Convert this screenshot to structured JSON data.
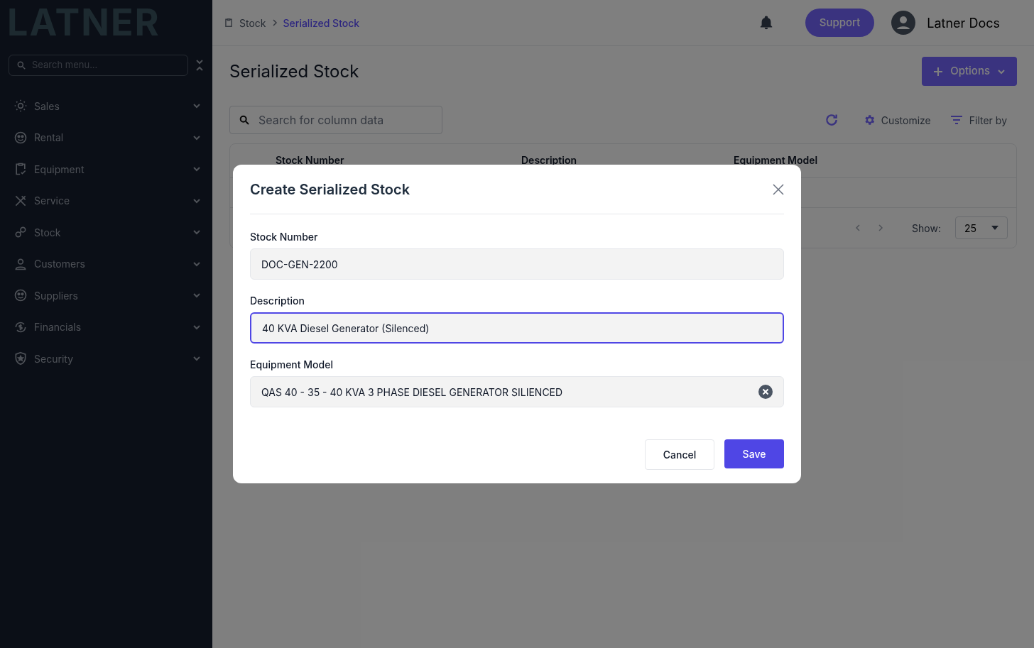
{
  "logo": {
    "text": "LATNER"
  },
  "sidebar": {
    "search_placeholder": "Search menu...",
    "items": [
      {
        "label": "Sales"
      },
      {
        "label": "Rental"
      },
      {
        "label": "Equipment"
      },
      {
        "label": "Service"
      },
      {
        "label": "Stock"
      },
      {
        "label": "Customers"
      },
      {
        "label": "Suppliers"
      },
      {
        "label": "Financials"
      },
      {
        "label": "Security"
      }
    ]
  },
  "header": {
    "breadcrumb": [
      {
        "label": "Stock",
        "selected": false
      },
      {
        "label": "Serialized Stock",
        "selected": true
      }
    ],
    "support": "Support",
    "user": "Latner Docs"
  },
  "page": {
    "title": "Serialized Stock",
    "options": "Options",
    "search_placeholder": "Search for column data",
    "customize": "Customize",
    "filter": "Filter by",
    "table": {
      "columns": [
        "Stock Number",
        "Description",
        "Equipment Model"
      ],
      "show_label": "Show:",
      "page_size": "25"
    }
  },
  "modal": {
    "title": "Create Serialized Stock",
    "fields": [
      {
        "label": "Stock Number",
        "value": "DOC-GEN-2200",
        "kind": "text",
        "focused": false
      },
      {
        "label": "Description",
        "value": "40 KVA Diesel Generator (Silenced)",
        "kind": "text",
        "focused": true
      },
      {
        "label": "Equipment Model",
        "value": "QAS 40 - 35 - 40 KVA 3 PHASE DIESEL GENERATOR SILIENCED",
        "kind": "select",
        "focused": false
      }
    ],
    "cancel": "Cancel",
    "save": "Save"
  }
}
